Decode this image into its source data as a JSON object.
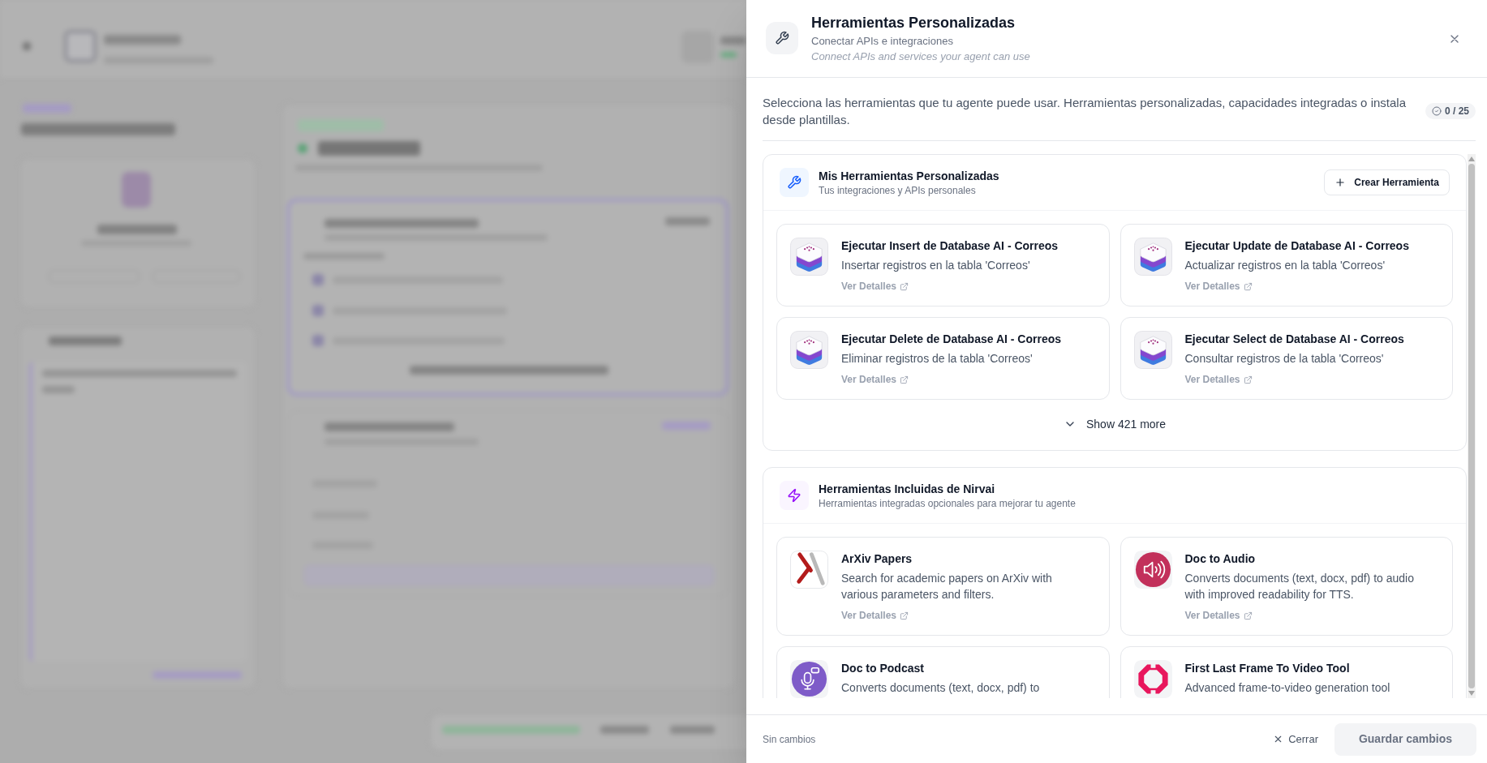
{
  "dialog": {
    "title": "Herramientas Personalizadas",
    "subtitle": "Conectar APIs e integraciones",
    "note": "Connect APIs and services your agent can use"
  },
  "intro": {
    "text": "Selecciona las herramientas que tu agente puede usar. Herramientas personalizadas, capacidades integradas o instala desde plantillas.",
    "counter": "0 / 25"
  },
  "sections": [
    {
      "title": "Mis Herramientas Personalizadas",
      "subtitle": "Tus integraciones y APIs personales",
      "button": "Crear Herramienta",
      "tools": [
        {
          "name": "Ejecutar Insert de Database AI - Correos",
          "description": "Insertar registros en la tabla 'Correos'",
          "link": "Ver Detalles"
        },
        {
          "name": "Ejecutar Update de Database AI - Correos",
          "description": "Actualizar registros en la tabla 'Correos'",
          "link": "Ver Detalles"
        },
        {
          "name": "Ejecutar Delete de Database AI - Correos",
          "description": "Eliminar registros de la tabla 'Correos'",
          "link": "Ver Detalles"
        },
        {
          "name": "Ejecutar Select de Database AI - Correos",
          "description": "Consultar registros de la tabla 'Correos'",
          "link": "Ver Detalles"
        }
      ],
      "show_more": "Show 421 more"
    },
    {
      "title": "Herramientas Incluidas de Nirvai",
      "subtitle": "Herramientas integradas opcionales para mejorar tu agente",
      "tools": [
        {
          "name": "ArXiv Papers",
          "description": "Search for academic papers on ArXiv with various parameters and filters.",
          "link": "Ver Detalles"
        },
        {
          "name": "Doc to Audio",
          "description": "Converts documents (text, docx, pdf) to audio with improved readability for TTS.",
          "link": "Ver Detalles"
        },
        {
          "name": "Doc to Podcast",
          "description": "Converts documents (text, docx, pdf) to"
        },
        {
          "name": "First Last Frame To Video Tool",
          "description": "Advanced frame-to-video generation tool"
        }
      ]
    }
  ],
  "footer": {
    "status": "Sin cambios",
    "close": "Cerrar",
    "save": {
      "label": "Guardar cambios",
      "disabled": true
    }
  }
}
